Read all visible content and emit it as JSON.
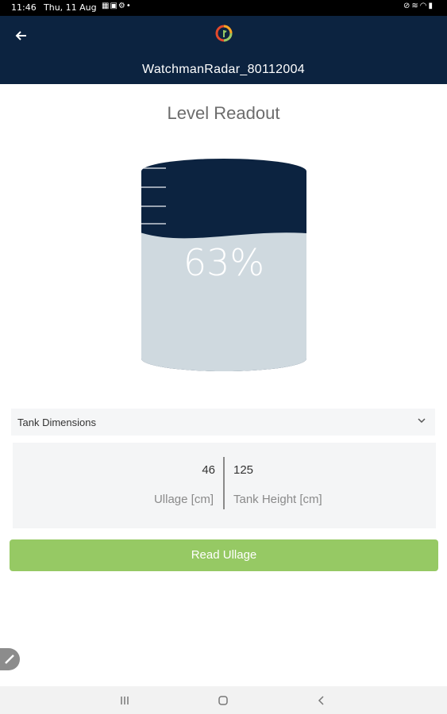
{
  "status_bar": {
    "time": "11:46",
    "date": "Thu, 11 Aug",
    "notification_icons": [
      "grid-icon",
      "image-icon",
      "settings-icon",
      "dot-icon"
    ],
    "system_icons": [
      "mute-icon",
      "vibrate-icon",
      "wifi-icon",
      "battery-icon"
    ]
  },
  "app_bar": {
    "background": "#0c2340",
    "device_name": "WatchmanRadar_80112004"
  },
  "readout": {
    "title": "Level Readout",
    "level_percent_text": "63%",
    "level_fraction": 0.63,
    "tank_fill_color": "#cfd9df",
    "tank_empty_color": "#0c2340"
  },
  "tank_dimensions": {
    "header_label": "Tank Dimensions",
    "ullage_value": "46",
    "ullage_label": "Ullage [cm]",
    "tank_height_value": "125",
    "tank_height_label": "Tank Height [cm]"
  },
  "actions": {
    "read_ullage_label": "Read Ullage",
    "button_color": "#96c964"
  },
  "nav_bar": {
    "buttons": [
      "recent-apps-icon",
      "home-icon",
      "back-icon"
    ]
  }
}
